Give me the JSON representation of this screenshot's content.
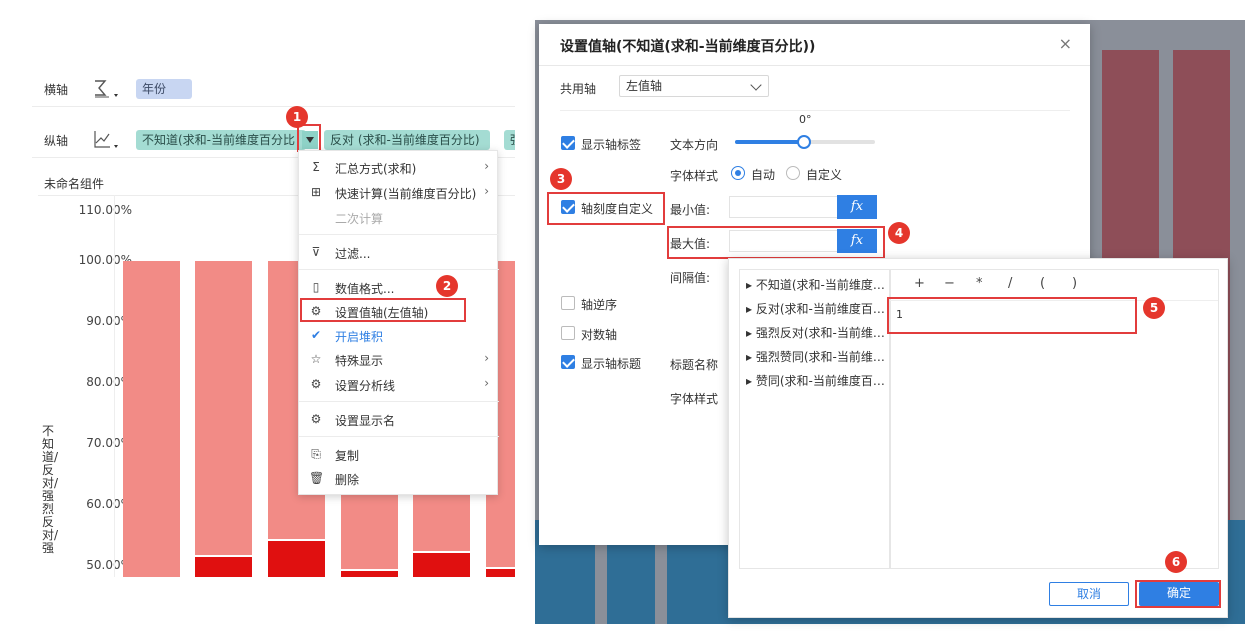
{
  "left": {
    "x_shelf_label": "横轴",
    "x_pill": "年份",
    "y_shelf_label": "纵轴",
    "y_pill_1": "不知道(求和-当前维度百分比",
    "y_pill_2": "反对 (求和-当前维度百分比)",
    "y_pill_3": "强",
    "component_title": "未命名组件",
    "y_ticks": [
      "110.00%",
      "100.00%",
      "90.00%",
      "80.00%",
      "70.00%",
      "60.00%",
      "50.00%"
    ],
    "y_axis_label": "不知道/反对/强烈反对/强",
    "bars_bottom_fraction": [
      0.0,
      0.04,
      0.1,
      0.04,
      0.07,
      0.05
    ]
  },
  "menu": {
    "items": [
      {
        "icon": "Σ",
        "label": "汇总方式(求和)",
        "arrow": "›"
      },
      {
        "icon": "⊞",
        "label": "快速计算(当前维度百分比)",
        "arrow": "›"
      },
      {
        "icon": "",
        "label": "二次计算",
        "arrow": ""
      },
      {
        "icon": "⊽",
        "label": "过滤...",
        "arrow": ""
      },
      {
        "icon": "▯",
        "label": "数值格式...",
        "arrow": ""
      },
      {
        "icon": "⚙",
        "label": "设置值轴(左值轴)",
        "arrow": ""
      },
      {
        "icon": "✔",
        "label": "开启堆积",
        "arrow": ""
      },
      {
        "icon": "☆",
        "label": "特殊显示",
        "arrow": "›"
      },
      {
        "icon": "⚙",
        "label": "设置分析线",
        "arrow": "›"
      },
      {
        "icon": "⚙",
        "label": "设置显示名",
        "arrow": ""
      },
      {
        "icon": "⎘",
        "label": "复制",
        "arrow": ""
      },
      {
        "icon": "🗑",
        "label": "删除",
        "arrow": ""
      }
    ]
  },
  "markers": [
    "1",
    "2",
    "3",
    "4",
    "5",
    "6"
  ],
  "dialog": {
    "title": "设置值轴(不知道(求和-当前维度百分比))",
    "close": "×",
    "shared_axis_label": "共用轴",
    "shared_axis_value": "左值轴",
    "show_axis_label": "显示轴标签",
    "text_direction_label": "文本方向",
    "angle": "0°",
    "font_style_label": "字体样式",
    "auto": "自动",
    "custom": "自定义",
    "axis_custom_label": "轴刻度自定义",
    "min_label": "最小值:",
    "max_label": "最大值:",
    "interval_label": "间隔值:",
    "reverse_label": "轴逆序",
    "log_label": "对数轴",
    "show_title_label": "显示轴标题",
    "title_name_label": "标题名称",
    "font_style_label_2": "字体样式",
    "fx": "fx"
  },
  "formula": {
    "fields": [
      "不知道(求和-当前维度…",
      "反对(求和-当前维度百…",
      "强烈反对(求和-当前维…",
      "强烈赞同(求和-当前维…",
      "赞同(求和-当前维度百…"
    ],
    "ops": [
      "+",
      "−",
      "*",
      "/",
      "(",
      ")"
    ],
    "value": "1",
    "cancel": "取消",
    "ok": "确定"
  }
}
